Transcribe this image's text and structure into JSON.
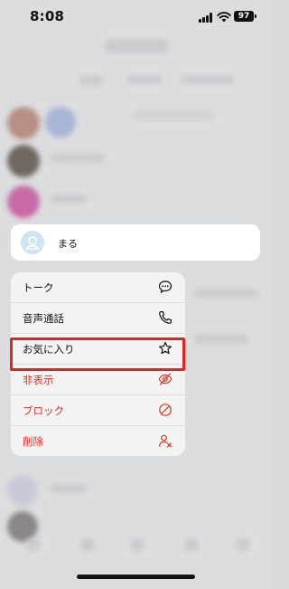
{
  "status_bar": {
    "time": "8:08",
    "battery": "97"
  },
  "contact": {
    "name": "まる",
    "avatar_icon": "person-icon"
  },
  "menu": {
    "items": [
      {
        "label": "トーク",
        "icon": "chat-bubble-icon",
        "destructive": false
      },
      {
        "label": "音声通話",
        "icon": "phone-icon",
        "destructive": false
      },
      {
        "label": "お気に入り",
        "icon": "star-icon",
        "destructive": false
      },
      {
        "label": "非表示",
        "icon": "eye-slash-icon",
        "destructive": true
      },
      {
        "label": "ブロック",
        "icon": "block-icon",
        "destructive": true
      },
      {
        "label": "削除",
        "icon": "delete-user-icon",
        "destructive": true
      }
    ]
  },
  "colors": {
    "destructive": "#e0301f",
    "highlight": "#e8221b",
    "avatar": "#cfe3f2"
  }
}
